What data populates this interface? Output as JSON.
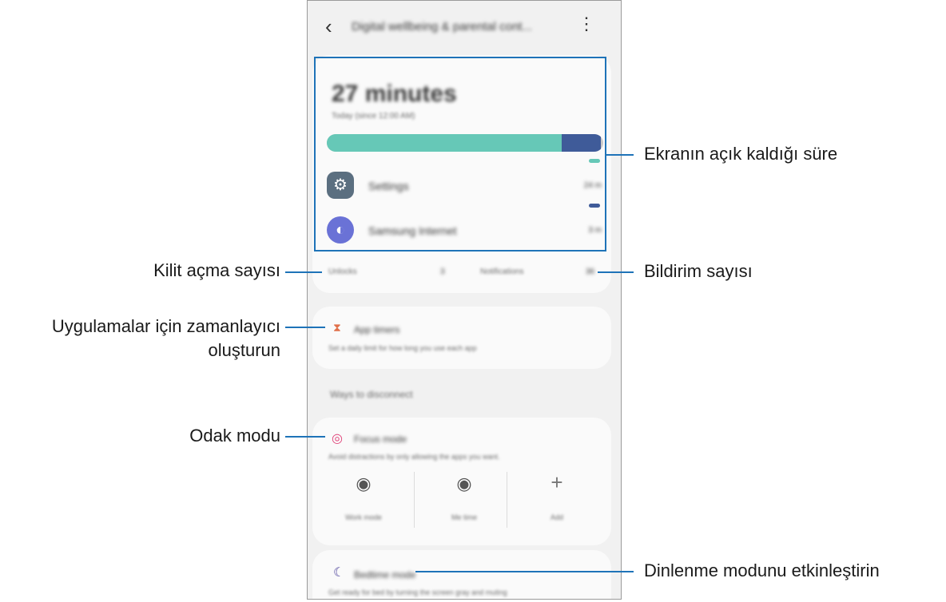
{
  "header": {
    "back_icon": "chevron-left-icon",
    "title": "Digital wellbeing & parental cont...",
    "more_icon": "more-vertical-icon"
  },
  "screen_time": {
    "total": "27 minutes",
    "subtitle": "Today (since 12:00 AM)",
    "usage_bar": {
      "settings_fraction": 0.85,
      "internet_fraction": 0.14
    },
    "colors": {
      "settings": "#66c8b7",
      "internet": "#3f5b99",
      "rest": "#c9c9c9"
    },
    "apps": [
      {
        "name": "Settings",
        "time": "24 m",
        "icon": "settings-icon",
        "color": "#66c8b7"
      },
      {
        "name": "Samsung Internet",
        "time": "3 m",
        "icon": "internet-icon",
        "color": "#3f5b99"
      }
    ]
  },
  "stats": {
    "unlocks_label": "Unlocks",
    "unlocks_value": "3",
    "notifications_label": "Notifications",
    "notifications_value": "36"
  },
  "app_timers": {
    "icon": "hourglass-icon",
    "title": "App timers",
    "description": "Set a daily limit for how long you use each app"
  },
  "ways_to_disconnect": {
    "heading": "Ways to disconnect"
  },
  "focus_mode": {
    "icon": "target-icon",
    "title": "Focus mode",
    "description": "Avoid distractions by only allowing the apps you want.",
    "modes": [
      {
        "label": "Work mode",
        "icon": "work-mode-icon"
      },
      {
        "label": "Me time",
        "icon": "me-time-icon"
      },
      {
        "label": "Add",
        "icon": "plus-icon"
      }
    ]
  },
  "bedtime_mode": {
    "icon": "moon-icon",
    "title": "Bedtime mode",
    "description": "Get ready for bed by turning the screen gray and muting"
  },
  "callouts": {
    "screen_time": "Ekranın açık kaldığı süre",
    "unlocks": "Kilit açma sayısı",
    "notifications": "Bildirim sayısı",
    "app_timers_line1": "Uygulamalar için zamanlayıcı",
    "app_timers_line2": "oluşturun",
    "focus_mode": "Odak modu",
    "bedtime": "Dinlenme modunu etkinleştirin"
  },
  "accent_color": "#1e73b8"
}
